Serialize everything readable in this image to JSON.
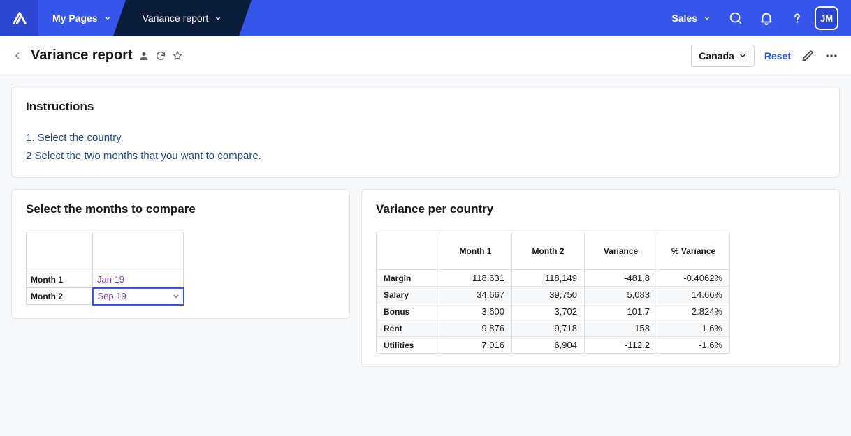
{
  "nav": {
    "my_pages": "My Pages",
    "active_tab": "Variance report",
    "sales": "Sales",
    "avatar": "JM"
  },
  "header": {
    "title": "Variance report",
    "country": "Canada",
    "reset": "Reset"
  },
  "instructions": {
    "title": "Instructions",
    "line1": "1. Select the country.",
    "line2": "2 Select the two months that you want to compare."
  },
  "selector": {
    "title": "Select the months to compare",
    "row1_label": "Month 1",
    "row1_value": "Jan 19",
    "row2_label": "Month 2",
    "row2_value": "Sep 19"
  },
  "variance": {
    "title": "Variance per country",
    "cols": [
      "Month 1",
      "Month 2",
      "Variance",
      "% Variance"
    ],
    "rows": [
      {
        "label": "Margin",
        "m1": "118,631",
        "m2": "118,149",
        "var": "-481.8",
        "pct": "-0.4062%"
      },
      {
        "label": "Salary",
        "m1": "34,667",
        "m2": "39,750",
        "var": "5,083",
        "pct": "14.66%"
      },
      {
        "label": "Bonus",
        "m1": "3,600",
        "m2": "3,702",
        "var": "101.7",
        "pct": "2.824%"
      },
      {
        "label": "Rent",
        "m1": "9,876",
        "m2": "9,718",
        "var": "-158",
        "pct": "-1.6%"
      },
      {
        "label": "Utilities",
        "m1": "7,016",
        "m2": "6,904",
        "var": "-112.2",
        "pct": "-1.6%"
      }
    ]
  }
}
